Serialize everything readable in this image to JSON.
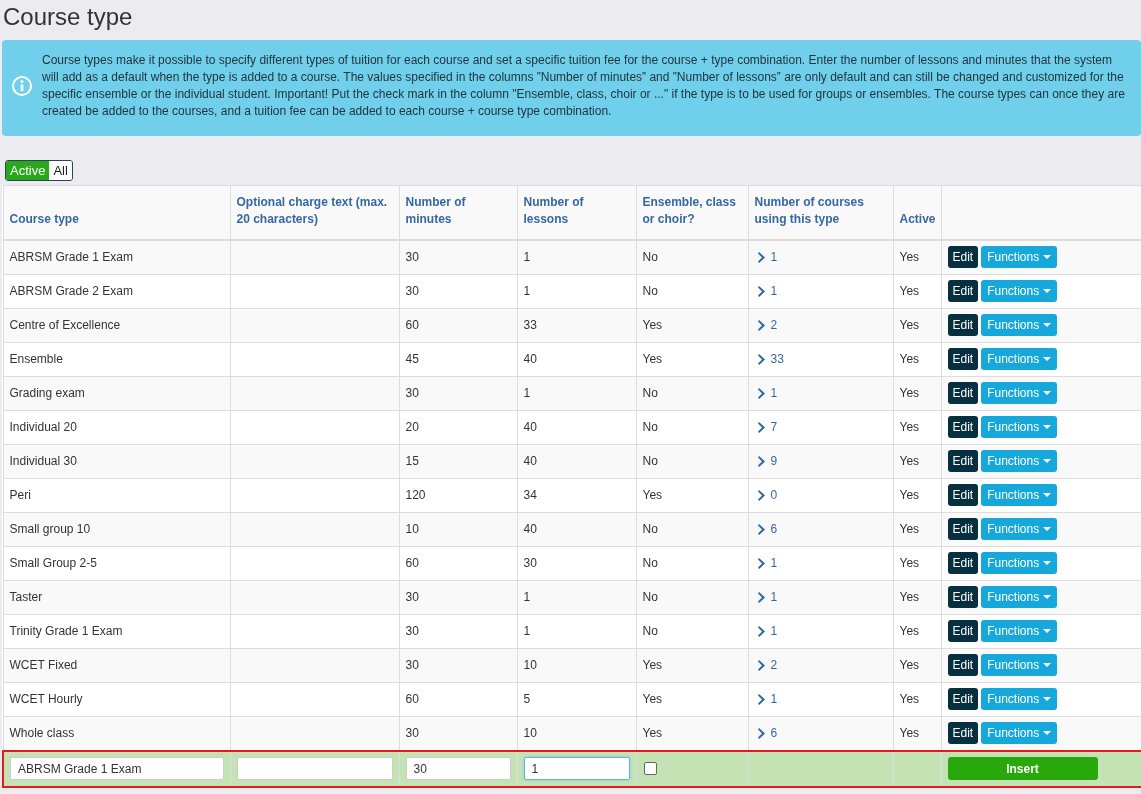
{
  "page": {
    "title": "Course type"
  },
  "info": {
    "text": "Course types make it possible to specify different types of tuition for each course and set a specific tuition fee for the course + type combination. Enter the number of lessons and minutes that the system will add as a default when the type is added to a course. The values specified in the columns ”Number of minutes” and ”Number of lessons” are only default and can still be changed and customized for the specific ensemble or the individual student. Important! Put the check mark in the column \"Ensemble, class, choir or ...\" if the type is to be used for groups or ensembles. The course types can once they are created be added to the courses, and a tuition fee can be added to each course + course type combination."
  },
  "filter": [
    {
      "label": "Active",
      "selected": true
    },
    {
      "label": "All",
      "selected": false
    }
  ],
  "table": {
    "columns": [
      "Course type",
      "Optional charge text (max. 20 characters)",
      "Number of minutes",
      "Number of lessons",
      "Ensemble, class or choir?",
      "Number of courses using this type",
      "Active"
    ],
    "rows": [
      {
        "course_type": "ABRSM Grade 1 Exam",
        "minutes": "30",
        "lessons": "1",
        "ensemble": "No",
        "courses": "1",
        "active": "Yes",
        "actions": [
          "Edit",
          "Functions"
        ]
      },
      {
        "course_type": "ABRSM Grade 2 Exam",
        "minutes": "30",
        "lessons": "1",
        "ensemble": "No",
        "courses": "1",
        "active": "Yes",
        "actions": [
          "Edit",
          "Functions"
        ]
      },
      {
        "course_type": "Centre of Excellence",
        "minutes": "60",
        "lessons": "33",
        "ensemble": "Yes",
        "courses": "2",
        "active": "Yes",
        "actions": [
          "Edit",
          "Functions"
        ]
      },
      {
        "course_type": "Ensemble",
        "minutes": "45",
        "lessons": "40",
        "ensemble": "Yes",
        "courses": "33",
        "active": "Yes",
        "actions": [
          "Edit",
          "Functions"
        ]
      },
      {
        "course_type": "Grading exam",
        "minutes": "30",
        "lessons": "1",
        "ensemble": "No",
        "courses": "1",
        "active": "Yes",
        "actions": [
          "Edit",
          "Functions"
        ]
      },
      {
        "course_type": "Individual 20",
        "minutes": "20",
        "lessons": "40",
        "ensemble": "No",
        "courses": "7",
        "active": "Yes",
        "actions": [
          "Edit",
          "Functions"
        ]
      },
      {
        "course_type": "Individual 30",
        "minutes": "15",
        "lessons": "40",
        "ensemble": "No",
        "courses": "9",
        "active": "Yes",
        "actions": [
          "Edit",
          "Functions"
        ]
      },
      {
        "course_type": "Peri",
        "minutes": "120",
        "lessons": "34",
        "ensemble": "Yes",
        "courses": "0",
        "active": "Yes",
        "actions": [
          "Edit",
          "Functions"
        ]
      },
      {
        "course_type": "Small group 10",
        "minutes": "10",
        "lessons": "40",
        "ensemble": "No",
        "courses": "6",
        "active": "Yes",
        "actions": [
          "Edit",
          "Functions"
        ]
      },
      {
        "course_type": "Small Group 2-5",
        "minutes": "60",
        "lessons": "30",
        "ensemble": "No",
        "courses": "1",
        "active": "Yes",
        "actions": [
          "Edit",
          "Functions"
        ]
      },
      {
        "course_type": "Taster",
        "minutes": "30",
        "lessons": "1",
        "ensemble": "No",
        "courses": "1",
        "active": "Yes",
        "actions": [
          "Edit",
          "Functions"
        ]
      },
      {
        "course_type": "Trinity Grade 1 Exam",
        "minutes": "30",
        "lessons": "1",
        "ensemble": "No",
        "courses": "1",
        "active": "Yes",
        "actions": [
          "Edit",
          "Functions"
        ]
      },
      {
        "course_type": "WCET Fixed",
        "minutes": "30",
        "lessons": "10",
        "ensemble": "Yes",
        "courses": "2",
        "active": "Yes",
        "actions": [
          "Edit",
          "Functions"
        ]
      },
      {
        "course_type": "WCET Hourly",
        "minutes": "60",
        "lessons": "5",
        "ensemble": "Yes",
        "courses": "1",
        "active": "Yes",
        "actions": [
          "Edit",
          "Functions"
        ]
      },
      {
        "course_type": "Whole class",
        "minutes": "30",
        "lessons": "10",
        "ensemble": "Yes",
        "courses": "6",
        "active": "Yes",
        "actions": [
          "Edit",
          "Functions"
        ]
      }
    ]
  },
  "insert_row": {
    "fields": [
      {
        "kind": "text",
        "value": "ABRSM Grade 1 Exam",
        "focused": false
      },
      {
        "kind": "text",
        "focused": false
      },
      {
        "kind": "text",
        "value": "30",
        "focused": false
      },
      {
        "kind": "text",
        "value": "1",
        "focused": true
      },
      {
        "kind": "checkbox",
        "checked": false
      }
    ],
    "button": "Insert"
  }
}
